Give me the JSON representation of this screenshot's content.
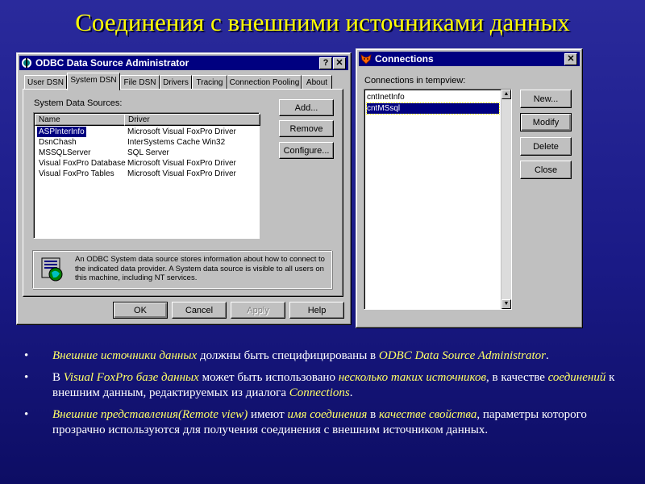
{
  "slide": {
    "title": "Соединения с внешними источниками данных"
  },
  "odbc": {
    "title": "ODBC Data Source Administrator",
    "help_button": "?",
    "close_button": "✕",
    "tabs": [
      "User DSN",
      "System DSN",
      "File DSN",
      "Drivers",
      "Tracing",
      "Connection Pooling",
      "About"
    ],
    "list_label": "System Data Sources:",
    "columns": [
      "Name",
      "Driver"
    ],
    "rows": [
      {
        "name": "ASPInterInfo",
        "driver": "Microsoft Visual FoxPro Driver"
      },
      {
        "name": "DsnChash",
        "driver": "InterSystems Cache Win32"
      },
      {
        "name": "MSSQLServer",
        "driver": "SQL Server"
      },
      {
        "name": "Visual FoxPro Database",
        "driver": "Microsoft Visual FoxPro Driver"
      },
      {
        "name": "Visual FoxPro Tables",
        "driver": "Microsoft Visual FoxPro Driver"
      }
    ],
    "buttons": {
      "add": "Add...",
      "remove": "Remove",
      "configure": "Configure..."
    },
    "info": "An ODBC System data source stores information about how to connect to the indicated data provider.   A System data source is visible to all users on this machine, including NT services.",
    "footer": {
      "ok": "OK",
      "cancel": "Cancel",
      "apply": "Apply",
      "help": "Help"
    }
  },
  "connections": {
    "title": "Connections",
    "close_button": "✕",
    "list_label": "Connections in tempview:",
    "items": [
      "cntInetInfo",
      "cntMSsql"
    ],
    "buttons": {
      "new": "New...",
      "modify": "Modify",
      "delete": "Delete",
      "close": "Close"
    }
  },
  "bullets": [
    {
      "dot": "•",
      "parts": [
        {
          "t": "Внешние источники данных",
          "y": true
        },
        {
          "t": " должны быть специфицированы в ",
          "y": false
        },
        {
          "t": "ODBC Data Source Administrator",
          "y": true
        },
        {
          "t": ".",
          "y": false
        }
      ]
    },
    {
      "dot": "•",
      "parts": [
        {
          "t": "В ",
          "y": false
        },
        {
          "t": "Visual FoxPro базе данных",
          "y": true
        },
        {
          "t": " может быть использовано ",
          "y": false
        },
        {
          "t": "несколько таких источников",
          "y": true
        },
        {
          "t": ", в качестве ",
          "y": false
        },
        {
          "t": "соединений",
          "y": true
        },
        {
          "t": " к внешним данным, редактируемых из диалога ",
          "y": false
        },
        {
          "t": "Connections",
          "y": true
        },
        {
          "t": ".",
          "y": false
        }
      ]
    },
    {
      "dot": "•",
      "parts": [
        {
          "t": "Внешние представления(Remote view)",
          "y": true
        },
        {
          "t": " имеют ",
          "y": false
        },
        {
          "t": "имя соединения",
          "y": true
        },
        {
          "t": " в ",
          "y": false
        },
        {
          "t": "качестве свойства",
          "y": true
        },
        {
          "t": ", параметры которого прозрачно используются для получения соединения с внешним источником данных.",
          "y": false
        }
      ]
    }
  ]
}
